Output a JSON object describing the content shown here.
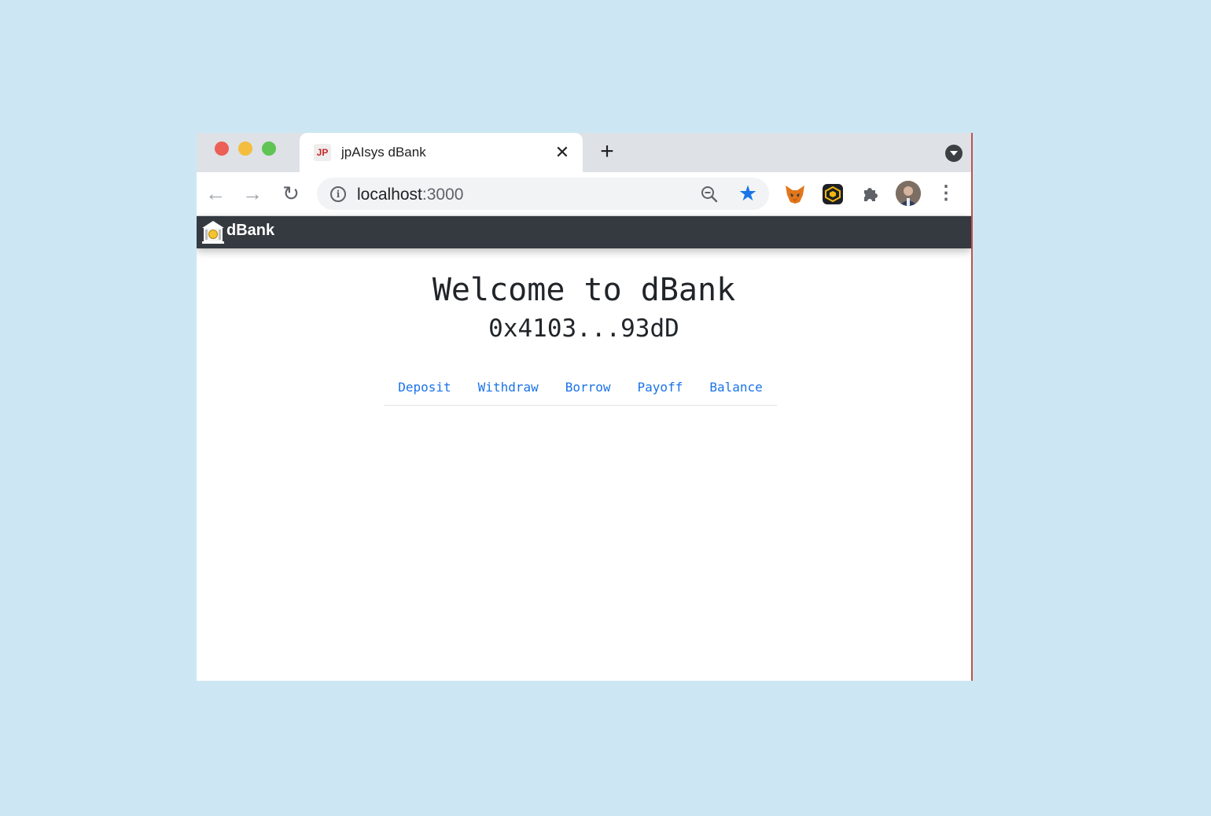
{
  "browser": {
    "tab": {
      "title": "jpAIsys dBank",
      "favicon_text": "JP"
    },
    "address_bar": {
      "host": "localhost",
      "port": ":3000"
    },
    "icons": {
      "close": "close-icon",
      "new_tab": "plus-icon",
      "tab_menu": "chevron-down-icon",
      "back": "arrow-left-icon",
      "forward": "arrow-right-icon",
      "reload": "reload-icon",
      "info": "info-icon",
      "zoom": "zoom-out-icon",
      "bookmark": "star-icon",
      "extensions": [
        "metamask-fox-icon",
        "binance-icon",
        "puzzle-icon"
      ],
      "profile": "avatar",
      "menu": "kebab-menu-icon"
    },
    "colors": {
      "accent": "#1a73e8",
      "tab_strip": "#dee1e6"
    }
  },
  "app": {
    "brand": "dBank",
    "navbar_color": "#343a40",
    "welcome": "Welcome to dBank",
    "account": "0x4103...93dD",
    "tabs": [
      "Deposit",
      "Withdraw",
      "Borrow",
      "Payoff",
      "Balance"
    ]
  }
}
